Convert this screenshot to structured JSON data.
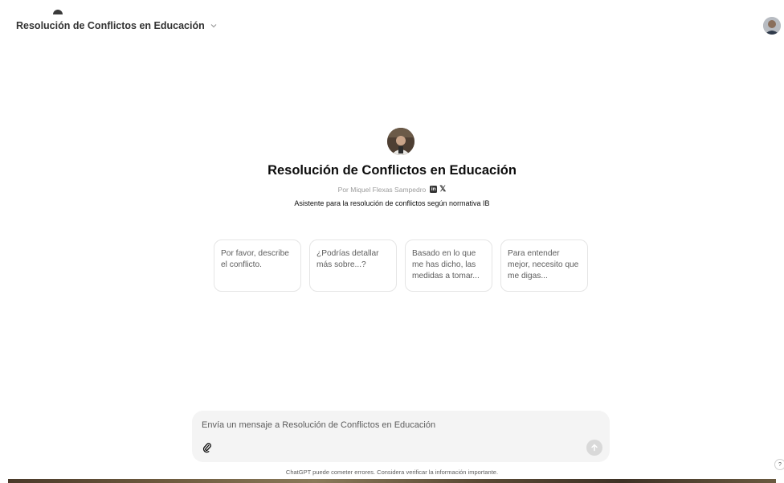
{
  "header": {
    "title": "Resolución de Conflictos en Educación",
    "title_chevron_icon": "chevron-down-icon",
    "user_avatar_icon": "user-avatar"
  },
  "gpt": {
    "name": "Resolución de Conflictos en Educación",
    "byline": "Por Miquel Flexas Sampedro",
    "social": {
      "linkedin": "in",
      "x": "𝕏"
    },
    "description": "Asistente para la resolución de conflictos según normativa IB"
  },
  "starters": [
    "Por favor, describe el conflicto.",
    "¿Podrías detallar más sobre...?",
    "Basado en lo que me has dicho, las medidas a tomar...",
    "Para entender mejor, necesito que me digas..."
  ],
  "composer": {
    "placeholder": "Envía un mensaje a Resolución de Conflictos en Educación",
    "attach_icon": "paperclip-icon",
    "send_icon": "arrow-up-icon"
  },
  "footer": {
    "disclaimer": "ChatGPT puede cometer errores. Considera verificar la información importante.",
    "help": "?"
  },
  "colors": {
    "text": "#0d0d0d",
    "muted": "#5d5d5d",
    "composer_bg": "#f4f4f4",
    "card_border": "#e5e5e5"
  }
}
